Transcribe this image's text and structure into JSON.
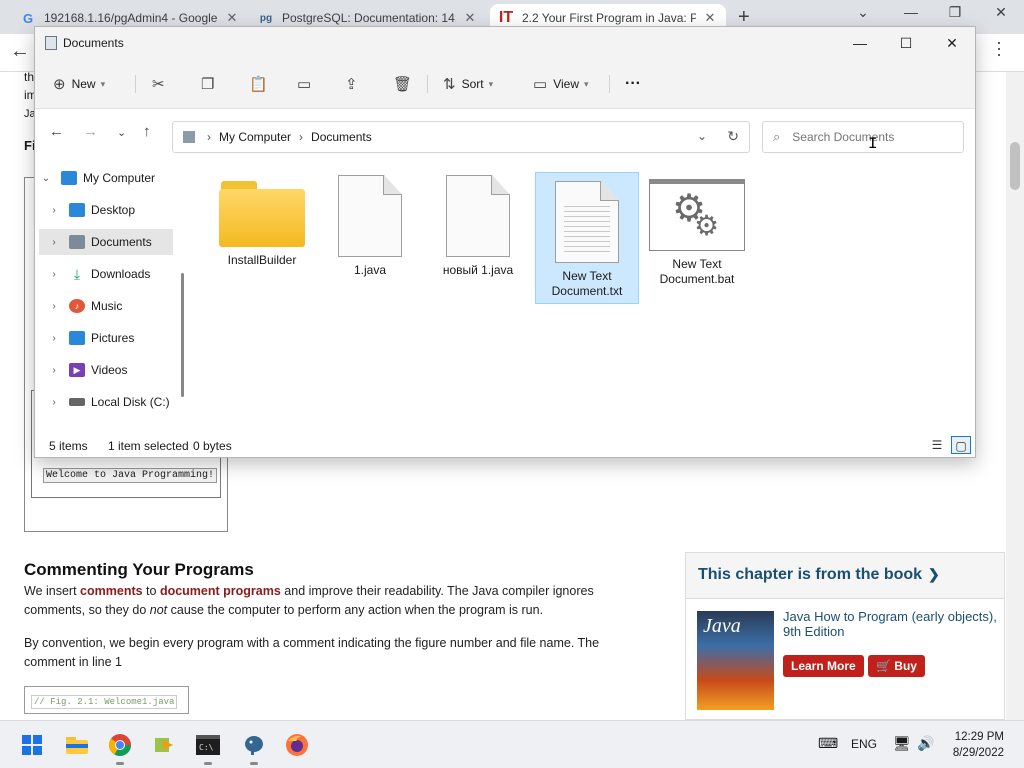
{
  "browser": {
    "tabs": [
      {
        "title": "192168.1.16/pgAdmin4 - Google",
        "favicon": "G"
      },
      {
        "title": "PostgreSQL: Documentation: 14:",
        "favicon": "pg"
      },
      {
        "title": "2.2 Your First Program in Java: Pr",
        "favicon": "IT"
      }
    ],
    "new_tab": "+"
  },
  "page": {
    "frag_th": "th",
    "frag_im": "im",
    "frag_ja": "Ja",
    "frag_fi": "Fi",
    "console_output": "Welcome to Java Programming!",
    "section_title": "Commenting Your Programs",
    "para1_a": "We insert ",
    "para1_kw1": "comments",
    "para1_b": " to ",
    "para1_kw2": "document programs",
    "para1_c": " and improve their readability. The Java compiler ignores comments, so they do ",
    "para1_em": "not",
    "para1_d": " cause the computer to perform any action when the program is run.",
    "para2": "By convention, we begin every program with a comment indicating the figure number and file name. The comment in line 1",
    "code_comment": "// Fig. 2.1: Welcome1.java",
    "promo": {
      "heading": "This chapter is from the book",
      "cover_text": "Java",
      "book_title": "Java How to Program (early objects), 9th Edition",
      "learn_more": "Learn More",
      "buy": "Buy"
    }
  },
  "explorer": {
    "title": "Documents",
    "toolbar": {
      "new": "New",
      "sort": "Sort",
      "view": "View",
      "more": "···"
    },
    "breadcrumb": [
      "My Computer",
      "Documents"
    ],
    "search_placeholder": "Search Documents",
    "tree": [
      {
        "label": "My Computer",
        "expanded": true,
        "color": "#2b88d8"
      },
      {
        "label": "Desktop",
        "color": "#2b88d8"
      },
      {
        "label": "Documents",
        "selected": true,
        "color": "#7d8b99"
      },
      {
        "label": "Downloads",
        "color": "#1e9e6a"
      },
      {
        "label": "Music",
        "color": "#e0573a"
      },
      {
        "label": "Pictures",
        "color": "#2b88d8"
      },
      {
        "label": "Videos",
        "color": "#7b3fb5"
      },
      {
        "label": "Local Disk (C:)",
        "color": "#666666"
      }
    ],
    "files": [
      {
        "name": "InstallBuilder",
        "type": "folder"
      },
      {
        "name": "1.java",
        "type": "document"
      },
      {
        "name": "новый 1.java",
        "type": "document"
      },
      {
        "name": "New Text Document.txt",
        "type": "text",
        "selected": true
      },
      {
        "name": "New Text Document.bat",
        "type": "batch"
      }
    ],
    "status": {
      "count": "5 items",
      "selected": "1 item selected",
      "size": "0 bytes"
    }
  },
  "taskbar": {
    "lang": "ENG",
    "time": "12:29 PM",
    "date": "8/29/2022"
  },
  "colors": {
    "accent": "#1a73e8",
    "selection": "#cce8ff",
    "promo_heading": "#1b4f72",
    "buy_red": "#c0221b"
  }
}
